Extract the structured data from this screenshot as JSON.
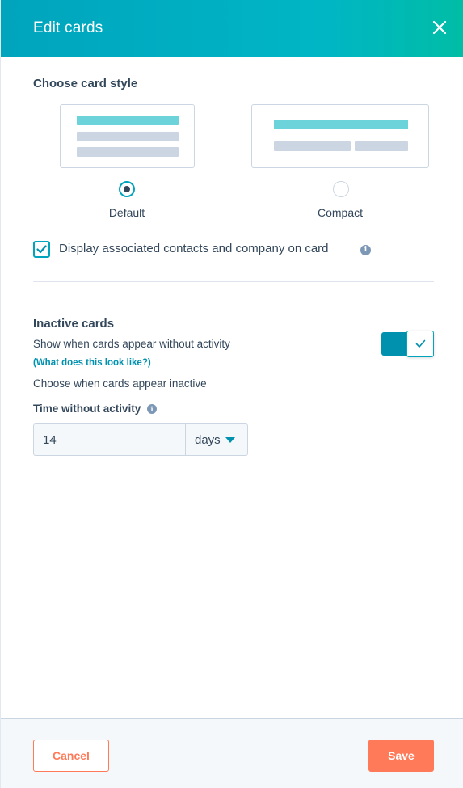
{
  "header": {
    "title": "Edit cards",
    "close_icon": "close-icon"
  },
  "card_style": {
    "title": "Choose card style",
    "options": [
      {
        "label": "Default",
        "selected": true
      },
      {
        "label": "Compact",
        "selected": false
      }
    ]
  },
  "display_associated": {
    "label": "Display associated contacts and company on card",
    "checked": true,
    "icon": "info-icon"
  },
  "inactive_cards": {
    "title": "Inactive cards",
    "description": "Show when cards appear without activity",
    "help_link": "(What does this look like?)",
    "choose_text": "Choose when cards appear inactive",
    "toggle_on": true
  },
  "time_without_activity": {
    "label": "Time without activity",
    "value": "14",
    "unit": "days",
    "icon": "info-icon"
  },
  "footer": {
    "cancel_label": "Cancel",
    "save_label": "Save"
  },
  "colors": {
    "header_gradient_start": "#00a4bd",
    "header_gradient_end": "#00bda5",
    "accent": "#00a4bd",
    "link": "#0091ae",
    "primary_button": "#ff7a59",
    "text": "#33475b"
  }
}
